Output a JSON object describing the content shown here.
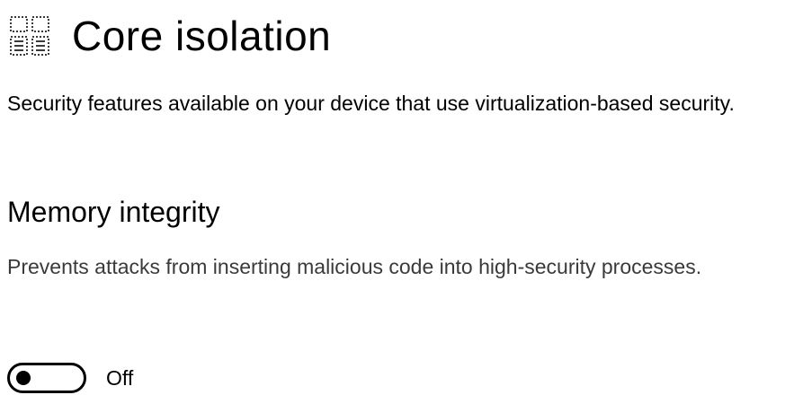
{
  "header": {
    "icon": "core-isolation-chip-icon",
    "title": "Core isolation"
  },
  "section": {
    "description": "Security features available on your device that use virtualization-based security."
  },
  "memory_integrity": {
    "heading": "Memory integrity",
    "description": "Prevents attacks from inserting malicious code into high-security processes.",
    "toggle": {
      "state": "off",
      "label": "Off"
    }
  },
  "colors": {
    "background": "#ffffff",
    "text": "#000000",
    "secondary_text": "#3a3a3a"
  }
}
